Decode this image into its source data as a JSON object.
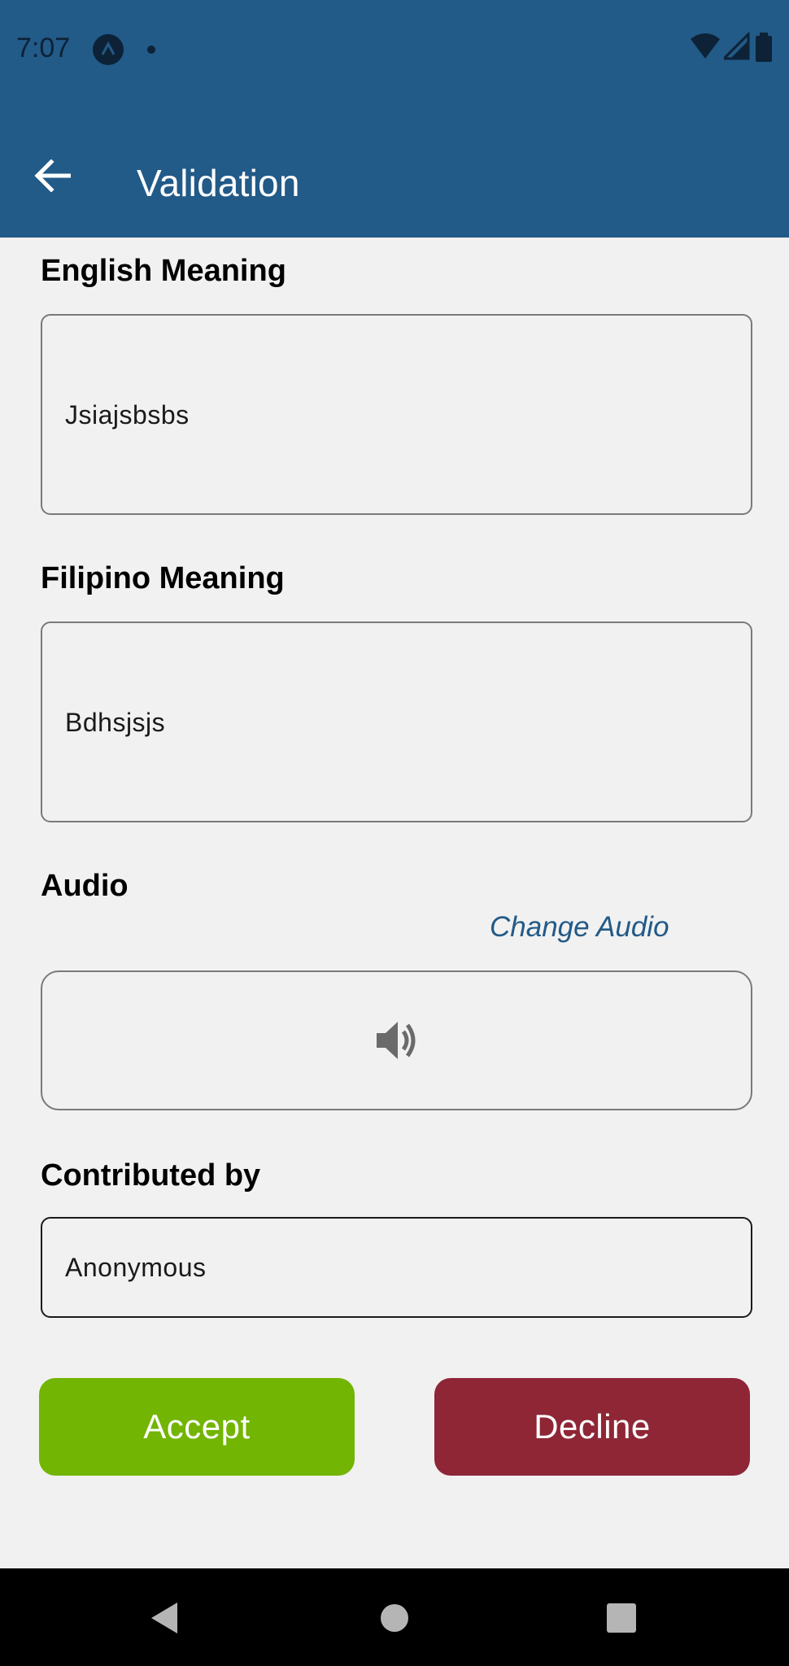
{
  "status_bar": {
    "time": "7:07",
    "icons": [
      "app-notification-icon",
      "dot-icon",
      "wifi-icon",
      "signal-icon",
      "battery-icon"
    ]
  },
  "toolbar": {
    "title": "Validation",
    "back_icon": "arrow-left-icon"
  },
  "form": {
    "english": {
      "label": "English Meaning",
      "value": "Jsiajsbsbs"
    },
    "filipino": {
      "label": "Filipino Meaning",
      "value": "Bdhsjsjs"
    },
    "audio": {
      "label": "Audio",
      "change_link": "Change Audio",
      "icon": "speaker-icon"
    },
    "contributor": {
      "label": "Contributed by",
      "value": "Anonymous"
    }
  },
  "actions": {
    "accept": "Accept",
    "decline": "Decline"
  },
  "colors": {
    "app_bar": "#225a88",
    "accept": "#72b503",
    "decline": "#8e2636",
    "link": "#225a88"
  },
  "nav_bar": {
    "icons": [
      "back-triangle-icon",
      "home-circle-icon",
      "recents-square-icon"
    ]
  }
}
